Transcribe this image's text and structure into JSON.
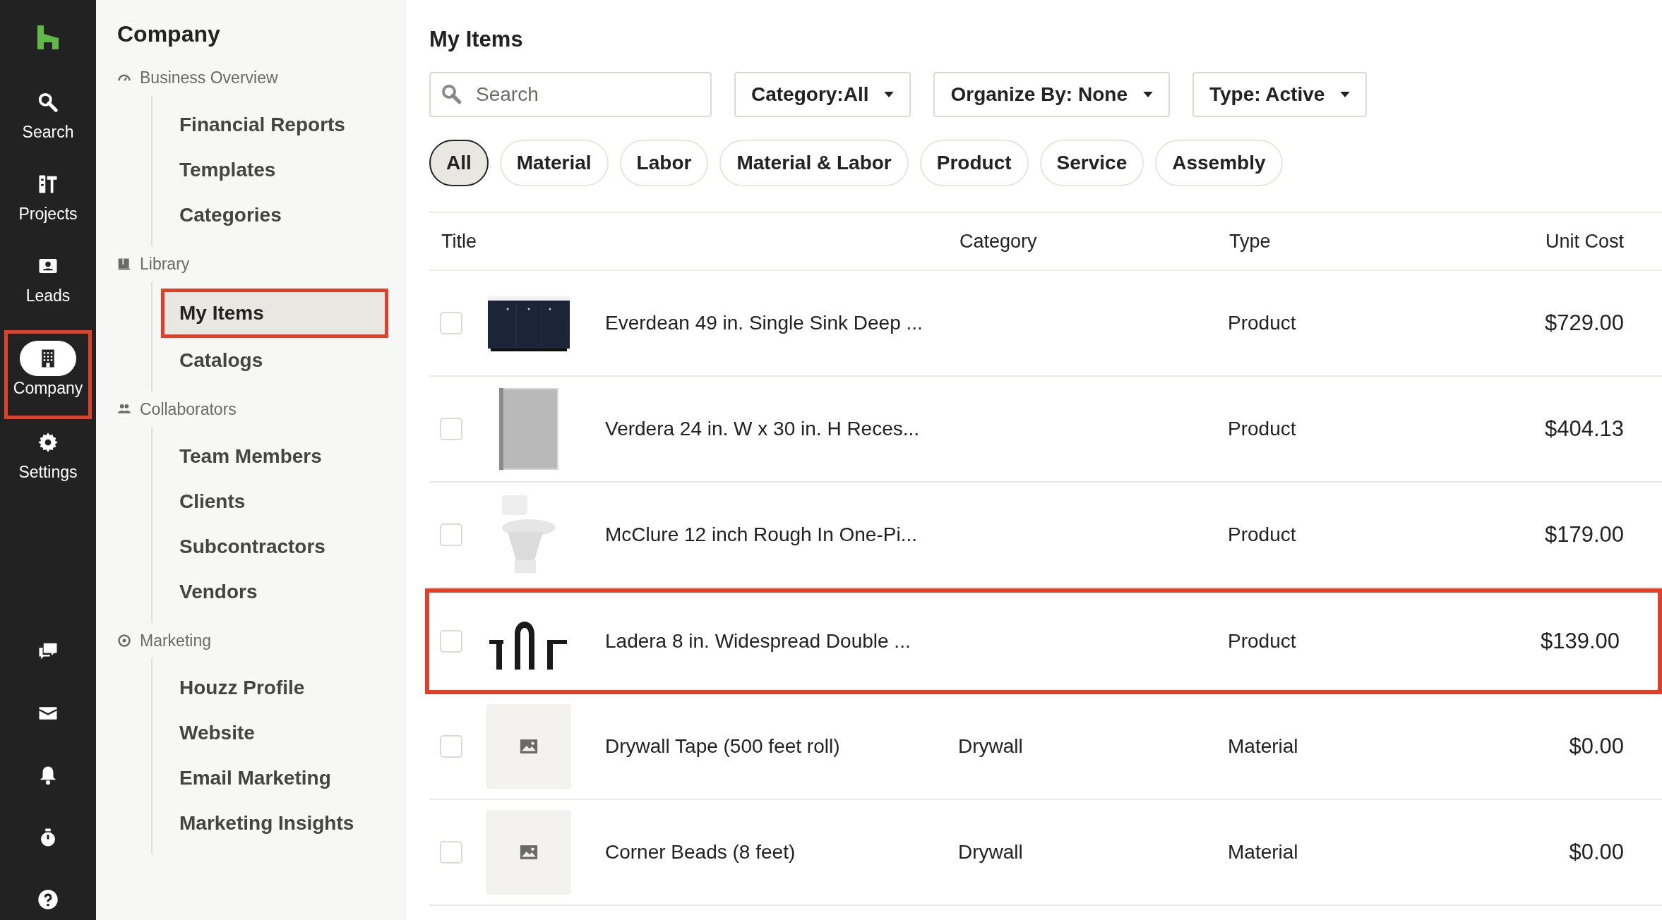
{
  "rail": {
    "items": [
      {
        "label": "Search",
        "selected": false,
        "highlighted": false
      },
      {
        "label": "Projects",
        "selected": false,
        "highlighted": false
      },
      {
        "label": "Leads",
        "selected": false,
        "highlighted": false
      },
      {
        "label": "Company",
        "selected": true,
        "highlighted": true
      },
      {
        "label": "Settings",
        "selected": false,
        "highlighted": false
      }
    ]
  },
  "sidebar": {
    "title": "Company",
    "sections": [
      {
        "label": "Business Overview",
        "items": [
          {
            "label": "Financial Reports",
            "selected": false,
            "highlighted": false
          },
          {
            "label": "Templates",
            "selected": false,
            "highlighted": false
          },
          {
            "label": "Categories",
            "selected": false,
            "highlighted": false
          }
        ]
      },
      {
        "label": "Library",
        "items": [
          {
            "label": "My Items",
            "selected": true,
            "highlighted": true
          },
          {
            "label": "Catalogs",
            "selected": false,
            "highlighted": false
          }
        ]
      },
      {
        "label": "Collaborators",
        "items": [
          {
            "label": "Team Members",
            "selected": false,
            "highlighted": false
          },
          {
            "label": "Clients",
            "selected": false,
            "highlighted": false
          },
          {
            "label": "Subcontractors",
            "selected": false,
            "highlighted": false
          },
          {
            "label": "Vendors",
            "selected": false,
            "highlighted": false
          }
        ]
      },
      {
        "label": "Marketing",
        "items": [
          {
            "label": "Houzz Profile",
            "selected": false,
            "highlighted": false
          },
          {
            "label": "Website",
            "selected": false,
            "highlighted": false
          },
          {
            "label": "Email Marketing",
            "selected": false,
            "highlighted": false
          },
          {
            "label": "Marketing Insights",
            "selected": false,
            "highlighted": false
          }
        ]
      }
    ]
  },
  "page_title": "My Items",
  "search": {
    "placeholder": "Search"
  },
  "dropdowns": [
    "Category:All",
    "Organize By: None",
    "Type: Active"
  ],
  "chips": [
    {
      "label": "All",
      "selected": true
    },
    {
      "label": "Material",
      "selected": false
    },
    {
      "label": "Labor",
      "selected": false
    },
    {
      "label": "Material & Labor",
      "selected": false
    },
    {
      "label": "Product",
      "selected": false
    },
    {
      "label": "Service",
      "selected": false
    },
    {
      "label": "Assembly",
      "selected": false
    }
  ],
  "table": {
    "columns": [
      "Title",
      "Category",
      "Type",
      "Unit Cost"
    ],
    "rows": [
      {
        "title": "Everdean 49 in. Single Sink Deep ...",
        "category": "",
        "type": "Product",
        "unit_cost": "$729.00",
        "checked": false,
        "highlighted": false
      },
      {
        "title": "Verdera 24 in. W x 30 in. H Reces...",
        "category": "",
        "type": "Product",
        "unit_cost": "$404.13",
        "checked": false,
        "highlighted": false
      },
      {
        "title": "McClure 12 inch Rough In One-Pi...",
        "category": "",
        "type": "Product",
        "unit_cost": "$179.00",
        "checked": false,
        "highlighted": false
      },
      {
        "title": "Ladera 8 in. Widespread Double ...",
        "category": "",
        "type": "Product",
        "unit_cost": "$139.00",
        "checked": false,
        "highlighted": true
      },
      {
        "kind": "placeholder",
        "title": "Drywall Tape (500 feet roll)",
        "category": "Drywall",
        "type": "Material",
        "unit_cost": "$0.00",
        "checked": false,
        "highlighted": false
      },
      {
        "kind": "placeholder",
        "title": "Corner Beads (8 feet)",
        "category": "Drywall",
        "type": "Material",
        "unit_cost": "$0.00",
        "checked": false,
        "highlighted": false
      }
    ]
  }
}
